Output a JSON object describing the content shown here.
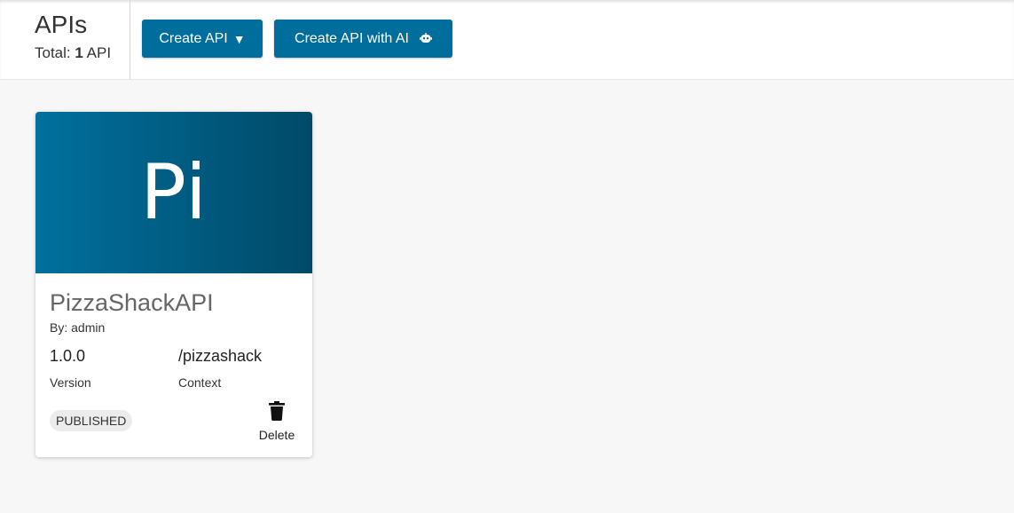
{
  "header": {
    "title": "APIs",
    "total_prefix": "Total:",
    "total_count": "1",
    "total_suffix": "API",
    "create_button": {
      "label": "Create API",
      "caret": "▼"
    },
    "create_ai_button": {
      "label": "Create API with AI",
      "icon": "robot-icon"
    }
  },
  "colors": {
    "primary": "#006e9c",
    "thumb_gradient_start": "#00709e",
    "thumb_gradient_end": "#004a68",
    "background": "#f7f7f7"
  },
  "apis": [
    {
      "thumbnail_text": "Pi",
      "name": "PizzaShackAPI",
      "by": "By: admin",
      "version": "1.0.0",
      "version_label": "Version",
      "context": "/pizzashack",
      "context_label": "Context",
      "status": "PUBLISHED",
      "delete_label": "Delete",
      "delete_icon": "trash-icon"
    }
  ]
}
